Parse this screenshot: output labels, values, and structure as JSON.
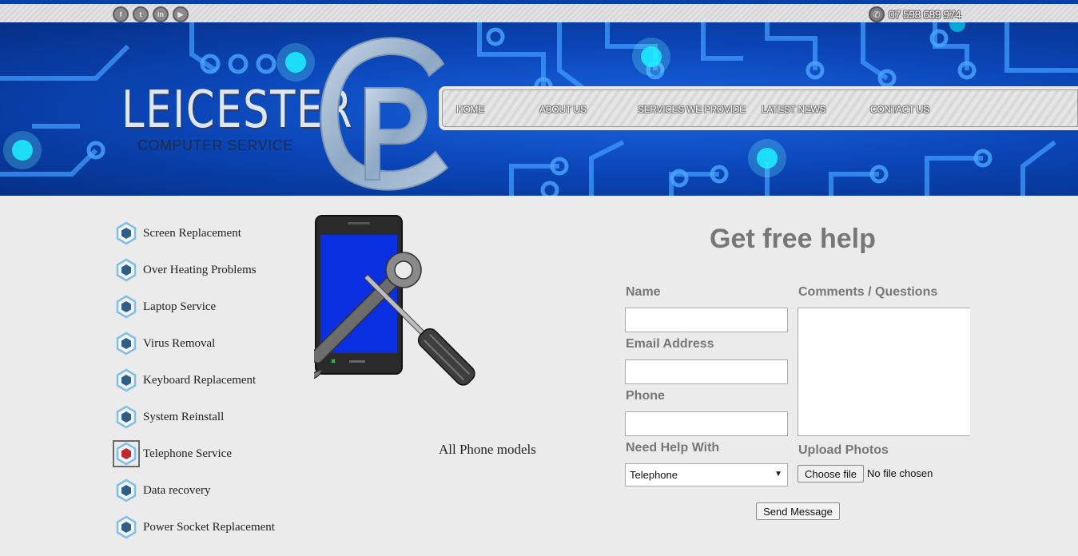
{
  "topbar": {
    "social": [
      {
        "icon": "facebook-icon",
        "glyph": "f"
      },
      {
        "icon": "twitter-icon",
        "glyph": "t"
      },
      {
        "icon": "linkedin-icon",
        "glyph": "in"
      },
      {
        "icon": "youtube-icon",
        "glyph": "▶"
      }
    ],
    "phone": "07 598 689 974"
  },
  "logo": {
    "title": "LEICESTER",
    "subtitle": "COMPUTER SERVICE"
  },
  "nav": {
    "items": [
      "HOME",
      "ABOUT US",
      "SERVICES WE PROVIDE",
      "LATEST NEWS",
      "CONTACT US"
    ]
  },
  "services": {
    "items": [
      {
        "label": "Screen Replacement",
        "active": false
      },
      {
        "label": "Over Heating Problems",
        "active": false
      },
      {
        "label": "Laptop Service",
        "active": false
      },
      {
        "label": "Virus Removal",
        "active": false
      },
      {
        "label": "Keyboard Replacement",
        "active": false
      },
      {
        "label": "System Reinstall",
        "active": false
      },
      {
        "label": "Telephone Service",
        "active": true
      },
      {
        "label": "Data recovery",
        "active": false
      },
      {
        "label": "Power Socket Replacement",
        "active": false
      }
    ]
  },
  "illustration": {
    "caption": "All Phone models"
  },
  "form": {
    "title": "Get free help",
    "name_label": "Name",
    "email_label": "Email Address",
    "phone_label": "Phone",
    "help_label": "Need Help With",
    "help_value": "Telephone",
    "comments_label": "Comments / Questions",
    "upload_label": "Upload Photos",
    "choose_file": "Choose file",
    "no_file": "No file chosen",
    "send": "Send Message"
  },
  "colors": {
    "brand_blue": "#0b46b8",
    "hex_normal": "#2f5f86",
    "hex_active": "#c0282a",
    "label_gray": "#777777"
  }
}
